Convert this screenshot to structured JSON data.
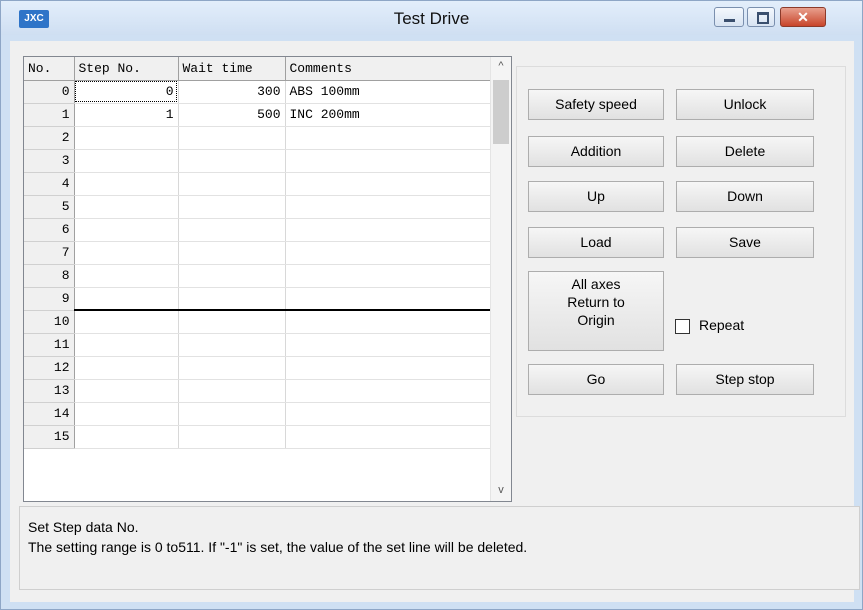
{
  "window": {
    "title": "Test Drive",
    "logo": "JXC",
    "controls": {
      "minimize": "minimize-icon",
      "maximize": "maximize-icon",
      "close": "✕"
    }
  },
  "grid": {
    "headers": [
      "No.",
      "Step No.",
      "Wait time",
      "Comments"
    ],
    "rows": [
      {
        "no": "0",
        "step": "0",
        "wait": "300",
        "comment": "ABS 100mm"
      },
      {
        "no": "1",
        "step": "1",
        "wait": "500",
        "comment": "INC 200mm"
      },
      {
        "no": "2",
        "step": "",
        "wait": "",
        "comment": ""
      },
      {
        "no": "3",
        "step": "",
        "wait": "",
        "comment": ""
      },
      {
        "no": "4",
        "step": "",
        "wait": "",
        "comment": ""
      },
      {
        "no": "5",
        "step": "",
        "wait": "",
        "comment": ""
      },
      {
        "no": "6",
        "step": "",
        "wait": "",
        "comment": ""
      },
      {
        "no": "7",
        "step": "",
        "wait": "",
        "comment": ""
      },
      {
        "no": "8",
        "step": "",
        "wait": "",
        "comment": ""
      },
      {
        "no": "9",
        "step": "",
        "wait": "",
        "comment": ""
      },
      {
        "no": "10",
        "step": "",
        "wait": "",
        "comment": ""
      },
      {
        "no": "11",
        "step": "",
        "wait": "",
        "comment": ""
      },
      {
        "no": "12",
        "step": "",
        "wait": "",
        "comment": ""
      },
      {
        "no": "13",
        "step": "",
        "wait": "",
        "comment": ""
      },
      {
        "no": "14",
        "step": "",
        "wait": "",
        "comment": ""
      },
      {
        "no": "15",
        "step": "",
        "wait": "",
        "comment": ""
      }
    ],
    "scroll_up_icon": "^",
    "scroll_down_icon": "v"
  },
  "buttons": {
    "safety_speed": "Safety speed",
    "unlock": "Unlock",
    "addition": "Addition",
    "delete": "Delete",
    "up": "Up",
    "down": "Down",
    "load": "Load",
    "save": "Save",
    "return_origin": [
      "All axes",
      "Return to",
      "Origin"
    ],
    "go": "Go",
    "step_stop": "Step stop"
  },
  "repeat": {
    "label": "Repeat",
    "checked": false
  },
  "info": {
    "line1": "Set Step data No.",
    "line2": "The setting range is 0 to511.  If \"-1\" is set, the value of the set line will be deleted."
  }
}
